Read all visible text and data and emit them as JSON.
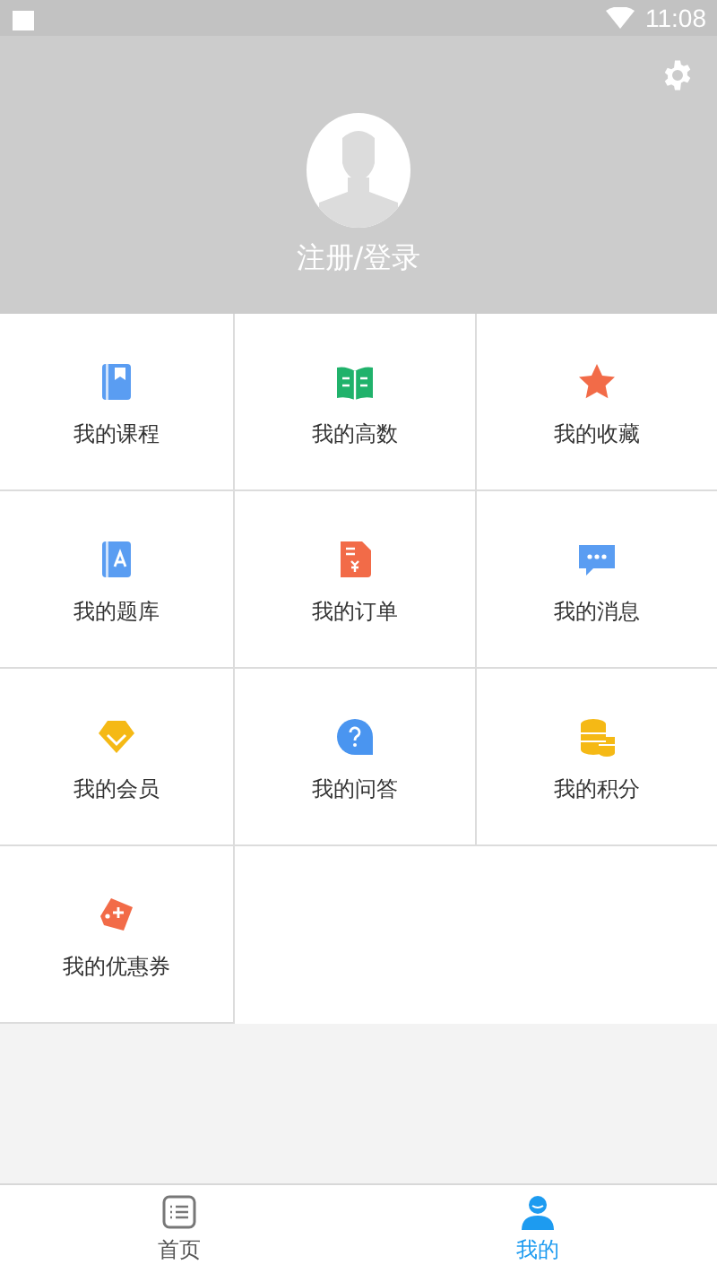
{
  "status_bar": {
    "time": "11:08"
  },
  "profile": {
    "login_label": "注册/登录"
  },
  "menu": [
    {
      "label": "我的课程"
    },
    {
      "label": "我的高数"
    },
    {
      "label": "我的收藏"
    },
    {
      "label": "我的题库"
    },
    {
      "label": "我的订单"
    },
    {
      "label": "我的消息"
    },
    {
      "label": "我的会员"
    },
    {
      "label": "我的问答"
    },
    {
      "label": "我的积分"
    },
    {
      "label": "我的优惠券"
    }
  ],
  "tabs": [
    {
      "label": "首页",
      "selected": false
    },
    {
      "label": "我的",
      "selected": true
    }
  ]
}
